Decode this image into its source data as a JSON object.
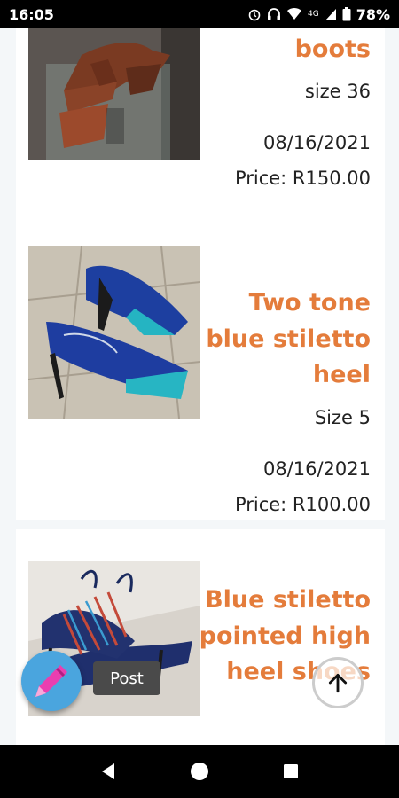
{
  "status": {
    "time": "16:05",
    "battery": "78%",
    "signal_label": "4G"
  },
  "listings": [
    {
      "title": "boots",
      "size": "size 36",
      "date": "08/16/2021",
      "price": "Price: R150.00",
      "image": "brown-boots-photo"
    },
    {
      "title": "Two tone blue stiletto heel",
      "size": "Size 5",
      "date": "08/16/2021",
      "price": "Price: R100.00",
      "image": "blue-teal-heels-photo"
    },
    {
      "title": "Blue stiletto pointed high heel shoes",
      "image": "blue-strappy-heels-photo"
    }
  ],
  "post_tooltip": "Post",
  "icons": {
    "fab": "pencil-icon",
    "scroll_top": "arrow-up-icon",
    "nav": [
      "back-icon",
      "home-icon",
      "recents-icon"
    ]
  },
  "colors": {
    "accent": "#e47c3b",
    "fab": "#4aa5de"
  }
}
